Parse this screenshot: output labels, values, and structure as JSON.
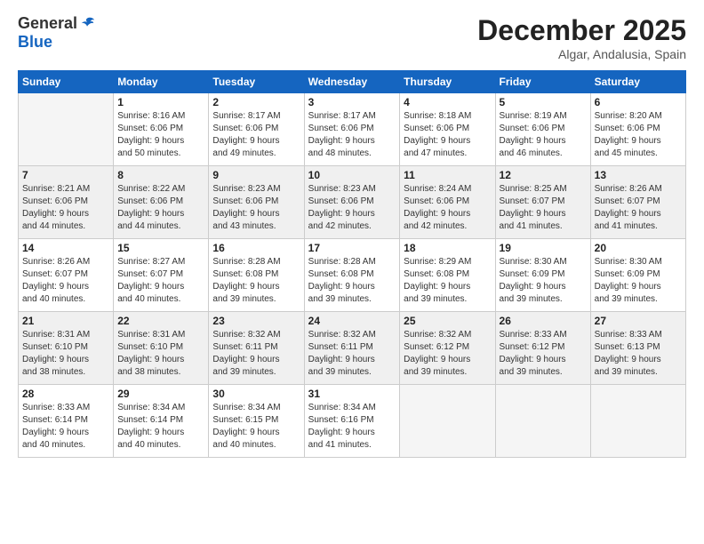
{
  "logo": {
    "general": "General",
    "blue": "Blue"
  },
  "title": "December 2025",
  "location": "Algar, Andalusia, Spain",
  "days_of_week": [
    "Sunday",
    "Monday",
    "Tuesday",
    "Wednesday",
    "Thursday",
    "Friday",
    "Saturday"
  ],
  "weeks": [
    {
      "shaded": false,
      "days": [
        {
          "num": "",
          "info": ""
        },
        {
          "num": "1",
          "info": "Sunrise: 8:16 AM\nSunset: 6:06 PM\nDaylight: 9 hours\nand 50 minutes."
        },
        {
          "num": "2",
          "info": "Sunrise: 8:17 AM\nSunset: 6:06 PM\nDaylight: 9 hours\nand 49 minutes."
        },
        {
          "num": "3",
          "info": "Sunrise: 8:17 AM\nSunset: 6:06 PM\nDaylight: 9 hours\nand 48 minutes."
        },
        {
          "num": "4",
          "info": "Sunrise: 8:18 AM\nSunset: 6:06 PM\nDaylight: 9 hours\nand 47 minutes."
        },
        {
          "num": "5",
          "info": "Sunrise: 8:19 AM\nSunset: 6:06 PM\nDaylight: 9 hours\nand 46 minutes."
        },
        {
          "num": "6",
          "info": "Sunrise: 8:20 AM\nSunset: 6:06 PM\nDaylight: 9 hours\nand 45 minutes."
        }
      ]
    },
    {
      "shaded": true,
      "days": [
        {
          "num": "7",
          "info": "Sunrise: 8:21 AM\nSunset: 6:06 PM\nDaylight: 9 hours\nand 44 minutes."
        },
        {
          "num": "8",
          "info": "Sunrise: 8:22 AM\nSunset: 6:06 PM\nDaylight: 9 hours\nand 44 minutes."
        },
        {
          "num": "9",
          "info": "Sunrise: 8:23 AM\nSunset: 6:06 PM\nDaylight: 9 hours\nand 43 minutes."
        },
        {
          "num": "10",
          "info": "Sunrise: 8:23 AM\nSunset: 6:06 PM\nDaylight: 9 hours\nand 42 minutes."
        },
        {
          "num": "11",
          "info": "Sunrise: 8:24 AM\nSunset: 6:06 PM\nDaylight: 9 hours\nand 42 minutes."
        },
        {
          "num": "12",
          "info": "Sunrise: 8:25 AM\nSunset: 6:07 PM\nDaylight: 9 hours\nand 41 minutes."
        },
        {
          "num": "13",
          "info": "Sunrise: 8:26 AM\nSunset: 6:07 PM\nDaylight: 9 hours\nand 41 minutes."
        }
      ]
    },
    {
      "shaded": false,
      "days": [
        {
          "num": "14",
          "info": "Sunrise: 8:26 AM\nSunset: 6:07 PM\nDaylight: 9 hours\nand 40 minutes."
        },
        {
          "num": "15",
          "info": "Sunrise: 8:27 AM\nSunset: 6:07 PM\nDaylight: 9 hours\nand 40 minutes."
        },
        {
          "num": "16",
          "info": "Sunrise: 8:28 AM\nSunset: 6:08 PM\nDaylight: 9 hours\nand 39 minutes."
        },
        {
          "num": "17",
          "info": "Sunrise: 8:28 AM\nSunset: 6:08 PM\nDaylight: 9 hours\nand 39 minutes."
        },
        {
          "num": "18",
          "info": "Sunrise: 8:29 AM\nSunset: 6:08 PM\nDaylight: 9 hours\nand 39 minutes."
        },
        {
          "num": "19",
          "info": "Sunrise: 8:30 AM\nSunset: 6:09 PM\nDaylight: 9 hours\nand 39 minutes."
        },
        {
          "num": "20",
          "info": "Sunrise: 8:30 AM\nSunset: 6:09 PM\nDaylight: 9 hours\nand 39 minutes."
        }
      ]
    },
    {
      "shaded": true,
      "days": [
        {
          "num": "21",
          "info": "Sunrise: 8:31 AM\nSunset: 6:10 PM\nDaylight: 9 hours\nand 38 minutes."
        },
        {
          "num": "22",
          "info": "Sunrise: 8:31 AM\nSunset: 6:10 PM\nDaylight: 9 hours\nand 38 minutes."
        },
        {
          "num": "23",
          "info": "Sunrise: 8:32 AM\nSunset: 6:11 PM\nDaylight: 9 hours\nand 39 minutes."
        },
        {
          "num": "24",
          "info": "Sunrise: 8:32 AM\nSunset: 6:11 PM\nDaylight: 9 hours\nand 39 minutes."
        },
        {
          "num": "25",
          "info": "Sunrise: 8:32 AM\nSunset: 6:12 PM\nDaylight: 9 hours\nand 39 minutes."
        },
        {
          "num": "26",
          "info": "Sunrise: 8:33 AM\nSunset: 6:12 PM\nDaylight: 9 hours\nand 39 minutes."
        },
        {
          "num": "27",
          "info": "Sunrise: 8:33 AM\nSunset: 6:13 PM\nDaylight: 9 hours\nand 39 minutes."
        }
      ]
    },
    {
      "shaded": false,
      "days": [
        {
          "num": "28",
          "info": "Sunrise: 8:33 AM\nSunset: 6:14 PM\nDaylight: 9 hours\nand 40 minutes."
        },
        {
          "num": "29",
          "info": "Sunrise: 8:34 AM\nSunset: 6:14 PM\nDaylight: 9 hours\nand 40 minutes."
        },
        {
          "num": "30",
          "info": "Sunrise: 8:34 AM\nSunset: 6:15 PM\nDaylight: 9 hours\nand 40 minutes."
        },
        {
          "num": "31",
          "info": "Sunrise: 8:34 AM\nSunset: 6:16 PM\nDaylight: 9 hours\nand 41 minutes."
        },
        {
          "num": "",
          "info": ""
        },
        {
          "num": "",
          "info": ""
        },
        {
          "num": "",
          "info": ""
        }
      ]
    }
  ]
}
